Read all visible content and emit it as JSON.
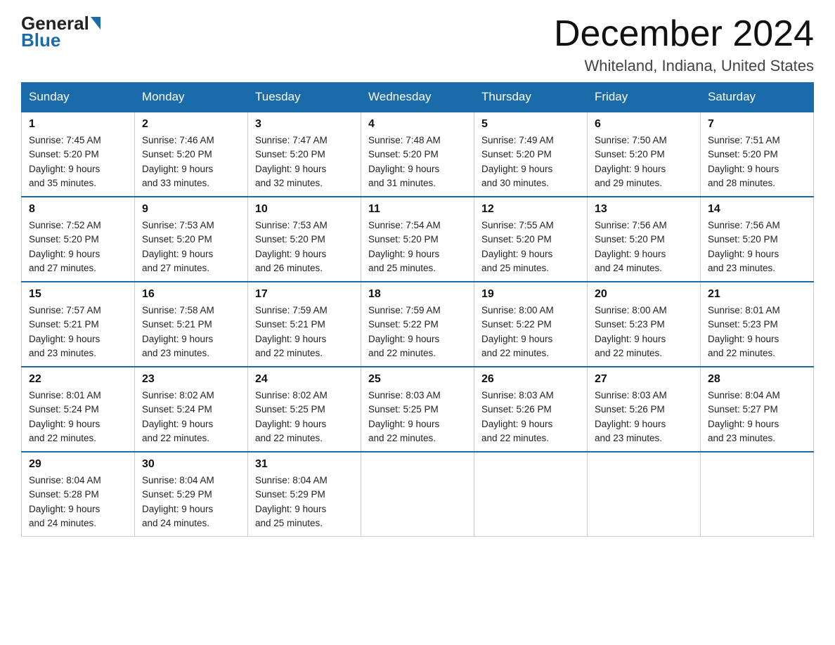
{
  "header": {
    "title": "December 2024",
    "location": "Whiteland, Indiana, United States",
    "logo": {
      "general": "General",
      "blue": "Blue"
    }
  },
  "weekdays": [
    "Sunday",
    "Monday",
    "Tuesday",
    "Wednesday",
    "Thursday",
    "Friday",
    "Saturday"
  ],
  "weeks": [
    [
      {
        "day": "1",
        "sunrise": "7:45 AM",
        "sunset": "5:20 PM",
        "daylight": "9 hours and 35 minutes."
      },
      {
        "day": "2",
        "sunrise": "7:46 AM",
        "sunset": "5:20 PM",
        "daylight": "9 hours and 33 minutes."
      },
      {
        "day": "3",
        "sunrise": "7:47 AM",
        "sunset": "5:20 PM",
        "daylight": "9 hours and 32 minutes."
      },
      {
        "day": "4",
        "sunrise": "7:48 AM",
        "sunset": "5:20 PM",
        "daylight": "9 hours and 31 minutes."
      },
      {
        "day": "5",
        "sunrise": "7:49 AM",
        "sunset": "5:20 PM",
        "daylight": "9 hours and 30 minutes."
      },
      {
        "day": "6",
        "sunrise": "7:50 AM",
        "sunset": "5:20 PM",
        "daylight": "9 hours and 29 minutes."
      },
      {
        "day": "7",
        "sunrise": "7:51 AM",
        "sunset": "5:20 PM",
        "daylight": "9 hours and 28 minutes."
      }
    ],
    [
      {
        "day": "8",
        "sunrise": "7:52 AM",
        "sunset": "5:20 PM",
        "daylight": "9 hours and 27 minutes."
      },
      {
        "day": "9",
        "sunrise": "7:53 AM",
        "sunset": "5:20 PM",
        "daylight": "9 hours and 27 minutes."
      },
      {
        "day": "10",
        "sunrise": "7:53 AM",
        "sunset": "5:20 PM",
        "daylight": "9 hours and 26 minutes."
      },
      {
        "day": "11",
        "sunrise": "7:54 AM",
        "sunset": "5:20 PM",
        "daylight": "9 hours and 25 minutes."
      },
      {
        "day": "12",
        "sunrise": "7:55 AM",
        "sunset": "5:20 PM",
        "daylight": "9 hours and 25 minutes."
      },
      {
        "day": "13",
        "sunrise": "7:56 AM",
        "sunset": "5:20 PM",
        "daylight": "9 hours and 24 minutes."
      },
      {
        "day": "14",
        "sunrise": "7:56 AM",
        "sunset": "5:20 PM",
        "daylight": "9 hours and 23 minutes."
      }
    ],
    [
      {
        "day": "15",
        "sunrise": "7:57 AM",
        "sunset": "5:21 PM",
        "daylight": "9 hours and 23 minutes."
      },
      {
        "day": "16",
        "sunrise": "7:58 AM",
        "sunset": "5:21 PM",
        "daylight": "9 hours and 23 minutes."
      },
      {
        "day": "17",
        "sunrise": "7:59 AM",
        "sunset": "5:21 PM",
        "daylight": "9 hours and 22 minutes."
      },
      {
        "day": "18",
        "sunrise": "7:59 AM",
        "sunset": "5:22 PM",
        "daylight": "9 hours and 22 minutes."
      },
      {
        "day": "19",
        "sunrise": "8:00 AM",
        "sunset": "5:22 PM",
        "daylight": "9 hours and 22 minutes."
      },
      {
        "day": "20",
        "sunrise": "8:00 AM",
        "sunset": "5:23 PM",
        "daylight": "9 hours and 22 minutes."
      },
      {
        "day": "21",
        "sunrise": "8:01 AM",
        "sunset": "5:23 PM",
        "daylight": "9 hours and 22 minutes."
      }
    ],
    [
      {
        "day": "22",
        "sunrise": "8:01 AM",
        "sunset": "5:24 PM",
        "daylight": "9 hours and 22 minutes."
      },
      {
        "day": "23",
        "sunrise": "8:02 AM",
        "sunset": "5:24 PM",
        "daylight": "9 hours and 22 minutes."
      },
      {
        "day": "24",
        "sunrise": "8:02 AM",
        "sunset": "5:25 PM",
        "daylight": "9 hours and 22 minutes."
      },
      {
        "day": "25",
        "sunrise": "8:03 AM",
        "sunset": "5:25 PM",
        "daylight": "9 hours and 22 minutes."
      },
      {
        "day": "26",
        "sunrise": "8:03 AM",
        "sunset": "5:26 PM",
        "daylight": "9 hours and 22 minutes."
      },
      {
        "day": "27",
        "sunrise": "8:03 AM",
        "sunset": "5:26 PM",
        "daylight": "9 hours and 23 minutes."
      },
      {
        "day": "28",
        "sunrise": "8:04 AM",
        "sunset": "5:27 PM",
        "daylight": "9 hours and 23 minutes."
      }
    ],
    [
      {
        "day": "29",
        "sunrise": "8:04 AM",
        "sunset": "5:28 PM",
        "daylight": "9 hours and 24 minutes."
      },
      {
        "day": "30",
        "sunrise": "8:04 AM",
        "sunset": "5:29 PM",
        "daylight": "9 hours and 24 minutes."
      },
      {
        "day": "31",
        "sunrise": "8:04 AM",
        "sunset": "5:29 PM",
        "daylight": "9 hours and 25 minutes."
      },
      null,
      null,
      null,
      null
    ]
  ],
  "labels": {
    "sunrise": "Sunrise:",
    "sunset": "Sunset:",
    "daylight": "Daylight:"
  }
}
